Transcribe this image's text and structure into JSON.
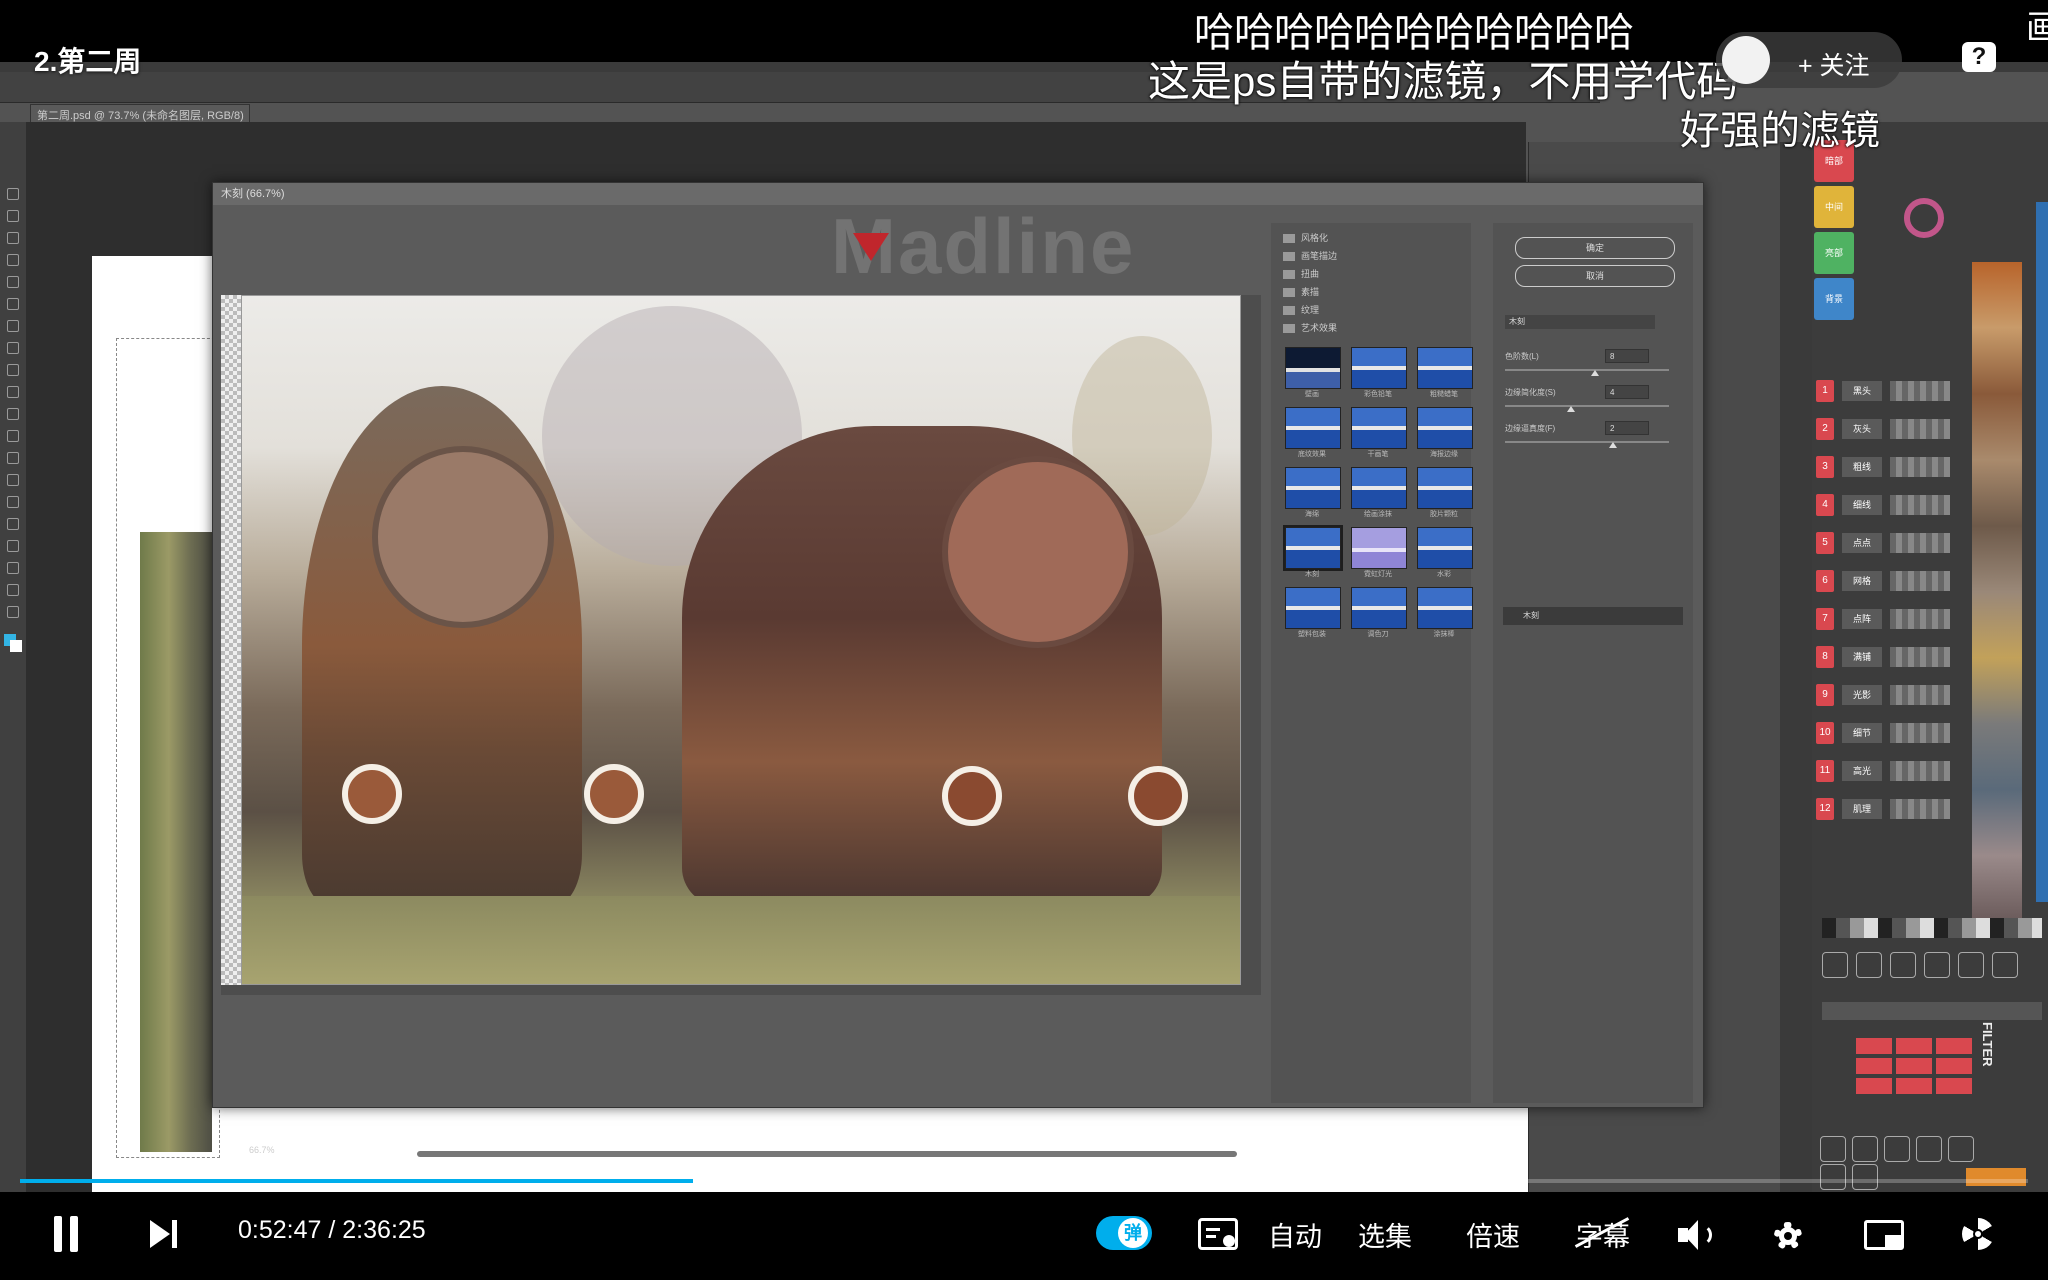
{
  "player": {
    "video_title": "2.第二周",
    "time_current": "0:52:47",
    "time_separator": "/",
    "time_total": "2:36:25",
    "progress_fraction": 0.335,
    "danmaku_toggle_glyph": "弹",
    "auto_label": "自动",
    "episodes_label": "选集",
    "speed_label": "倍速",
    "subtitle_label": "字幕",
    "follow_label": "+ 关注",
    "help_glyph": "?",
    "corner_glyph": "画",
    "accent_color": "#00aeec"
  },
  "danmaku": [
    {
      "text": "哈哈哈哈哈哈哈哈哈哈哈",
      "size": 40
    },
    {
      "text": "这是ps自带的滤镜，不用学代码",
      "size": 42
    },
    {
      "text": "好强的滤镜",
      "size": 40
    }
  ],
  "ps": {
    "doc_tab": "第二周.psd @ 73.7% (未命名图层, RGB/8)",
    "dialog_title": "木刻 (66.7%)",
    "zoom_label": "66.7%",
    "watermark": "Madline",
    "ok_label": "确定",
    "cancel_label": "取消",
    "filter_select": "木刻",
    "gallery_folders": [
      "风格化",
      "画笔描边",
      "扭曲",
      "素描",
      "纹理",
      "艺术效果"
    ],
    "thumbs": [
      {
        "label": "壁画",
        "style": "dark"
      },
      {
        "label": "彩色铅笔",
        "style": "blue"
      },
      {
        "label": "粗糙蜡笔",
        "style": "blue"
      },
      {
        "label": "底纹效果",
        "style": "blue"
      },
      {
        "label": "干画笔",
        "style": "blue"
      },
      {
        "label": "海报边缘",
        "style": "blue"
      },
      {
        "label": "海绵",
        "style": "blue"
      },
      {
        "label": "绘画涂抹",
        "style": "blue"
      },
      {
        "label": "胶片颗粒",
        "style": "blue"
      },
      {
        "label": "木刻",
        "style": "sel"
      },
      {
        "label": "霓虹灯光",
        "style": "lilac"
      },
      {
        "label": "水彩",
        "style": "blue"
      },
      {
        "label": "塑料包装",
        "style": "blue"
      },
      {
        "label": "调色刀",
        "style": "blue"
      },
      {
        "label": "涂抹棒",
        "style": "blue"
      }
    ],
    "params": [
      {
        "label": "色阶数(L)",
        "value": "8",
        "fraction": 0.55
      },
      {
        "label": "边缘简化度(S)",
        "value": "4",
        "fraction": 0.4
      },
      {
        "label": "边缘逼真度(F)",
        "value": "2",
        "fraction": 0.66
      }
    ],
    "effect_layer": "木刻",
    "swatches": [
      {
        "label": "暗部",
        "color": "#d9484f"
      },
      {
        "label": "中间",
        "color": "#e0b43a"
      },
      {
        "label": "亮部",
        "color": "#4fb262"
      },
      {
        "label": "背景",
        "color": "#3f86c9"
      }
    ],
    "layers": [
      "黑头",
      "灰头",
      "粗线",
      "细线",
      "点点",
      "网格",
      "点阵",
      "满铺",
      "光影",
      "细节",
      "高光",
      "肌理"
    ],
    "filter_text": "FILTER"
  }
}
